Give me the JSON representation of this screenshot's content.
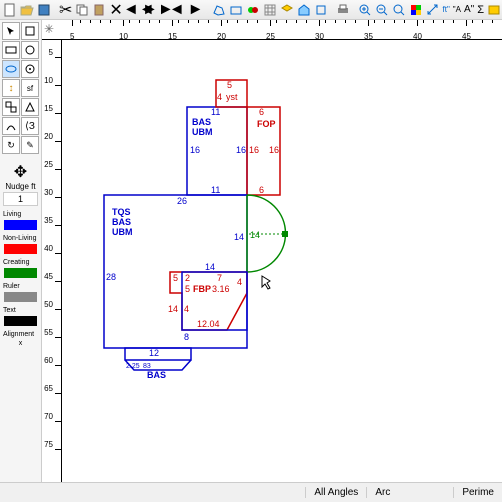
{
  "toolbar_icons": [
    "new",
    "open",
    "save",
    "cut",
    "copy",
    "paste",
    "undo",
    "redo",
    "back",
    "forward",
    "line",
    "poly",
    "toggle",
    "grid",
    "layer",
    "home",
    "ortho",
    "print",
    "zoom-in",
    "zoom-out",
    "zoom-fit",
    "select",
    "measure",
    "text",
    "font-small",
    "font-large",
    "sigma",
    "layers",
    "guide",
    "snap",
    "align"
  ],
  "left_tools": [
    "select",
    "line",
    "rect",
    "circle",
    "ellipse",
    "poly",
    "arrow",
    "arc",
    "group",
    "text",
    "curve",
    "angle",
    "rotate",
    "edit"
  ],
  "ruler_h": [
    5,
    10,
    15,
    20,
    25,
    30,
    35,
    40,
    45
  ],
  "ruler_v": [
    5,
    10,
    15,
    20,
    25,
    30,
    35,
    40,
    45,
    50,
    55,
    60,
    65,
    70,
    75
  ],
  "nudge": {
    "label": "Nudge ft",
    "value": "1"
  },
  "layers": [
    {
      "name": "Living",
      "color": "#0000ff"
    },
    {
      "name": "Non-Living",
      "color": "#ff0000"
    },
    {
      "name": "Creating",
      "color": "#008800"
    },
    {
      "name": "Ruler",
      "color": "#888888"
    },
    {
      "name": "Text",
      "color": "#000000"
    }
  ],
  "alignment": {
    "label": "Alignment",
    "value": "x"
  },
  "shapes": {
    "blue_rect1": {
      "labels": [
        "BAS",
        "UBM"
      ],
      "dims": {
        "top": "11",
        "left": "16",
        "bottom": "11",
        "right": "16",
        "topleft": "4"
      }
    },
    "red_rect1": {
      "label": "FOP",
      "dims": {
        "top": "6",
        "left": "16",
        "right": "16",
        "bottom": "6",
        "top2": "5",
        "sub": "yst"
      }
    },
    "blue_rect2": {
      "labels": [
        "TQS",
        "BAS",
        "UBM"
      ],
      "dims": {
        "top": "26",
        "left": "28",
        "bottom": "14",
        "right": "14"
      }
    },
    "red_poly": {
      "label": "FBP",
      "dims": [
        "5",
        "2",
        "7",
        "5",
        "3.16",
        "14",
        "4",
        "8",
        "12.04",
        "4"
      ]
    },
    "blue_rect3": {
      "label": "BAS",
      "dims": {
        "top": "12",
        "side": "2.25",
        "side2": "83"
      }
    },
    "green_arc": {
      "dims": {
        "left": "14",
        "right": "14"
      }
    }
  },
  "status": {
    "angles": "All Angles",
    "arc": "Arc",
    "perime": "Perime"
  }
}
